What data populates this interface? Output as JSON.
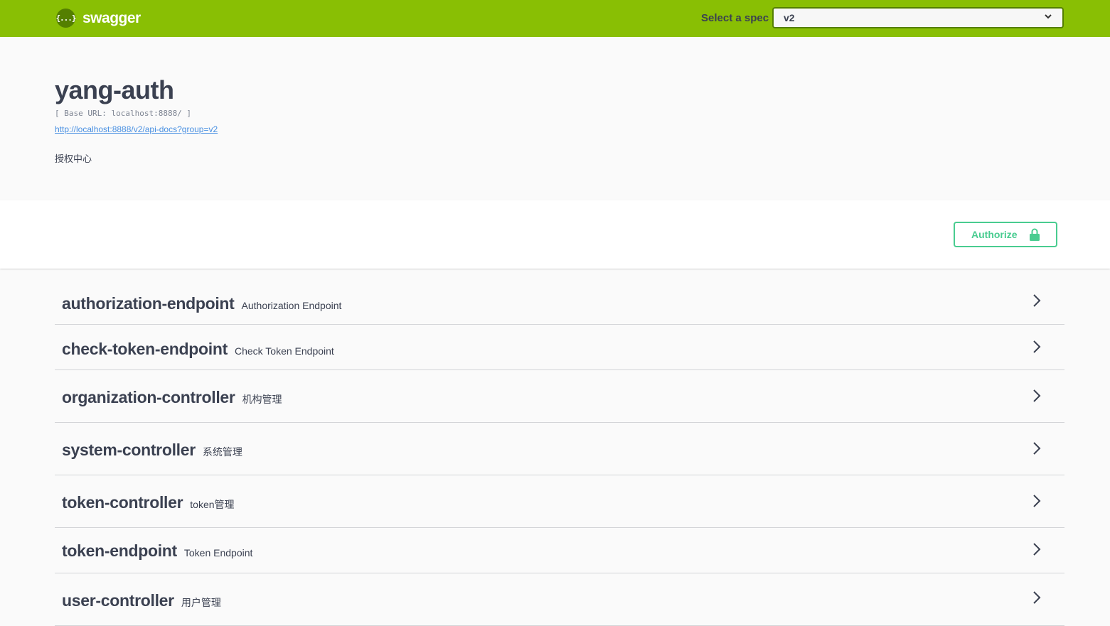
{
  "topbar": {
    "logo_badge": "{...}",
    "logo_text": "swagger",
    "spec_label": "Select a spec",
    "spec_selected": "v2",
    "colors": {
      "bar": "#89bf04",
      "dark": "#547f00"
    }
  },
  "info": {
    "title": "yang-auth",
    "base_url": "[ Base URL: localhost:8888/ ]",
    "doc_link": "http://localhost:8888/v2/api-docs?group=v2",
    "description": "授权中心"
  },
  "scheme": {
    "authorize_label": "Authorize",
    "authorize_color": "#49cc90"
  },
  "tags": [
    {
      "name": "authorization-endpoint",
      "description": "Authorization Endpoint"
    },
    {
      "name": "check-token-endpoint",
      "description": "Check Token Endpoint"
    },
    {
      "name": "organization-controller",
      "description": "机构管理"
    },
    {
      "name": "system-controller",
      "description": "系统管理"
    },
    {
      "name": "token-controller",
      "description": "token管理"
    },
    {
      "name": "token-endpoint",
      "description": "Token Endpoint"
    },
    {
      "name": "user-controller",
      "description": "用户管理"
    }
  ]
}
